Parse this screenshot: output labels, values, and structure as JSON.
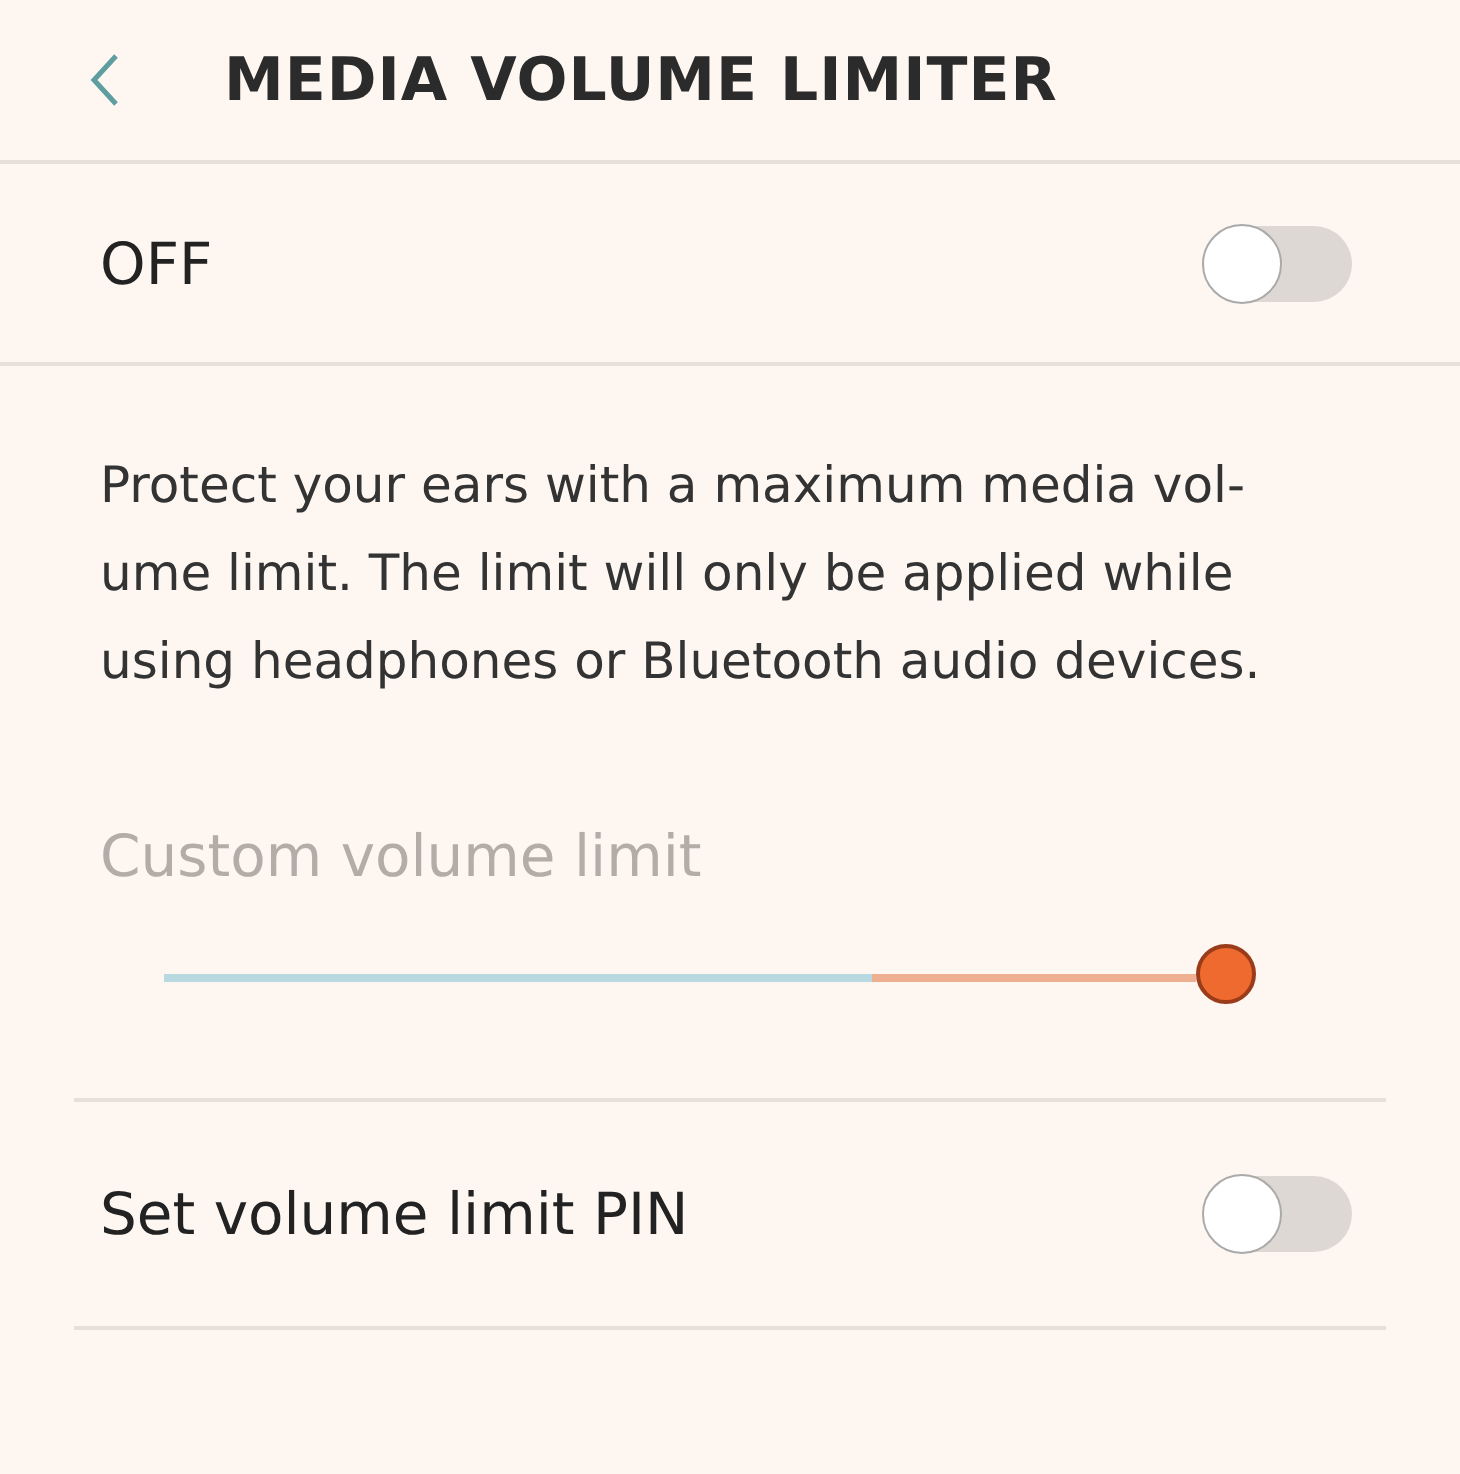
{
  "header": {
    "title": "MEDIA VOLUME LIMITER"
  },
  "master_switch": {
    "label": "OFF",
    "on": false
  },
  "description": "Protect your ears with a maximum media vol-\nume limit. The limit will only be applied while\nusing headphones or Bluetooth audio devices.",
  "volume_slider": {
    "label": "Custom volume limit",
    "disabled": true,
    "level": 1.0
  },
  "pin_switch": {
    "label": "Set volume limit PIN",
    "on": false
  }
}
